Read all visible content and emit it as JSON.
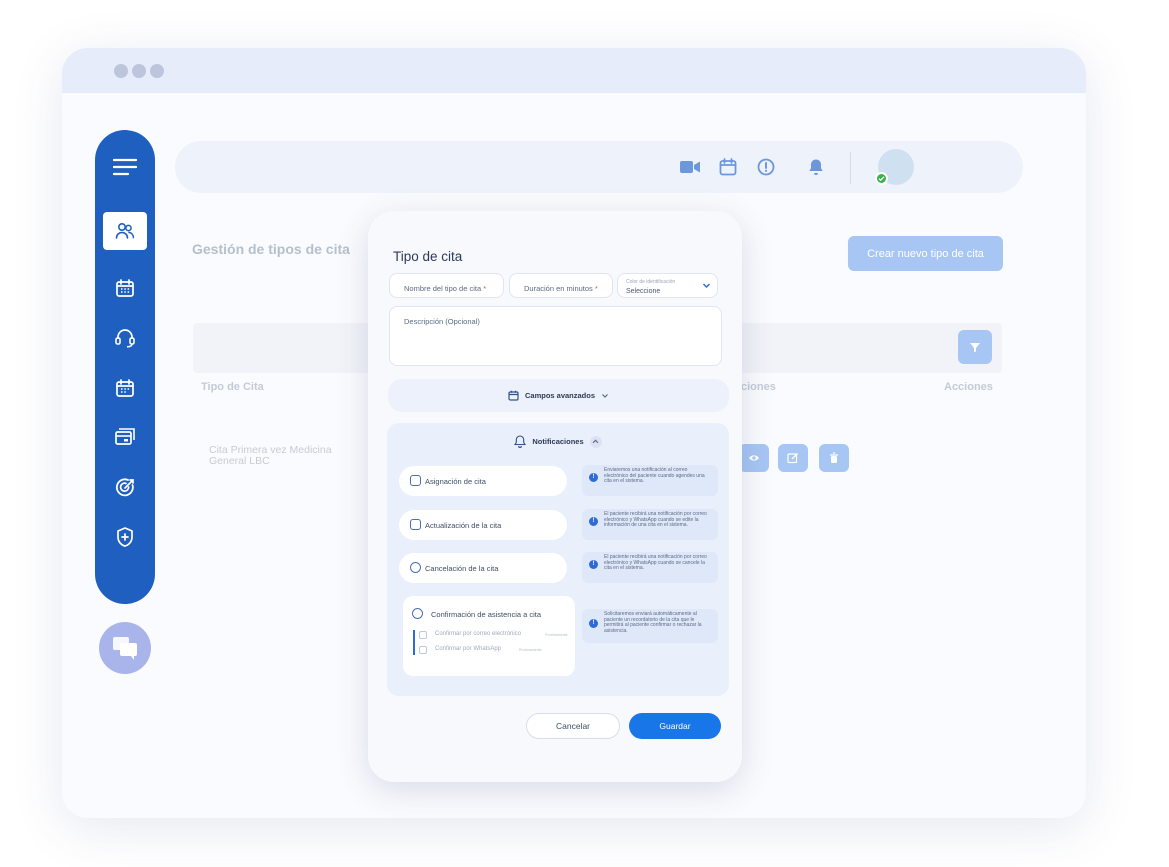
{
  "colors": {
    "sidebar": "#1f5fbf",
    "primary": "#1976e8",
    "muted_primary": "#a7c6f4",
    "chat_fab": "#a9b4ea",
    "status_online": "#37b24d"
  },
  "sidebar": {
    "items": [
      {
        "icon": "menu-icon"
      },
      {
        "icon": "users-icon",
        "active": true
      },
      {
        "icon": "calendar-icon"
      },
      {
        "icon": "headset-icon"
      },
      {
        "icon": "calendar-alt-icon"
      },
      {
        "icon": "payment-icon"
      },
      {
        "icon": "target-icon"
      },
      {
        "icon": "shield-icon"
      }
    ]
  },
  "topbar": {
    "icons": [
      "video-icon",
      "calendar-icon",
      "alert-icon",
      "bell-icon"
    ]
  },
  "page": {
    "title": "Gestión de tipos de cita",
    "create_button": "Crear nuevo tipo de cita"
  },
  "table": {
    "columns": [
      "Tipo de Cita",
      "ciones",
      "Acciones"
    ],
    "rows": [
      {
        "name": "Cita Primera vez Medicina General LBC"
      }
    ]
  },
  "modal": {
    "title": "Tipo de cita",
    "fields": {
      "name_label": "Nombre del tipo de cita",
      "duration_label": "Duración en minutos",
      "required_mark": "*",
      "select_caption": "Color de identificación",
      "select_value": "Seleccione",
      "description_label": "Descripción (Opcional)"
    },
    "advanced_label": "Campos avanzados",
    "notifications": {
      "title": "Notificaciones",
      "items": [
        {
          "label": "Asignación de cita",
          "info": "Enviaremos una notificación al correo electrónico del paciente cuando agendes una cita en el sistema."
        },
        {
          "label": "Actualización de la cita",
          "info": "El paciente recibirá una notificación por correo electrónico y WhatsApp cuando se edite la información de una cita en el sistema."
        },
        {
          "label": "Cancelación de la cita",
          "info": "El paciente recibirá una notificación por correo electrónico y WhatsApp cuando se cancele la cita en el sistema."
        }
      ],
      "confirmation": {
        "label": "Confirmación de asistencia a cita",
        "info": "Solicitaremos enviará automáticamente al paciente un recordatorio de la cita que le permitirá al paciente confirmar o rechazar la asistencia.",
        "options": [
          {
            "label": "Confirmar por correo electrónico",
            "tag": "Próximamente"
          },
          {
            "label": "Confirmar por WhatsApp",
            "tag": "Próximamente"
          }
        ]
      }
    },
    "buttons": {
      "cancel": "Cancelar",
      "save": "Guardar"
    }
  }
}
